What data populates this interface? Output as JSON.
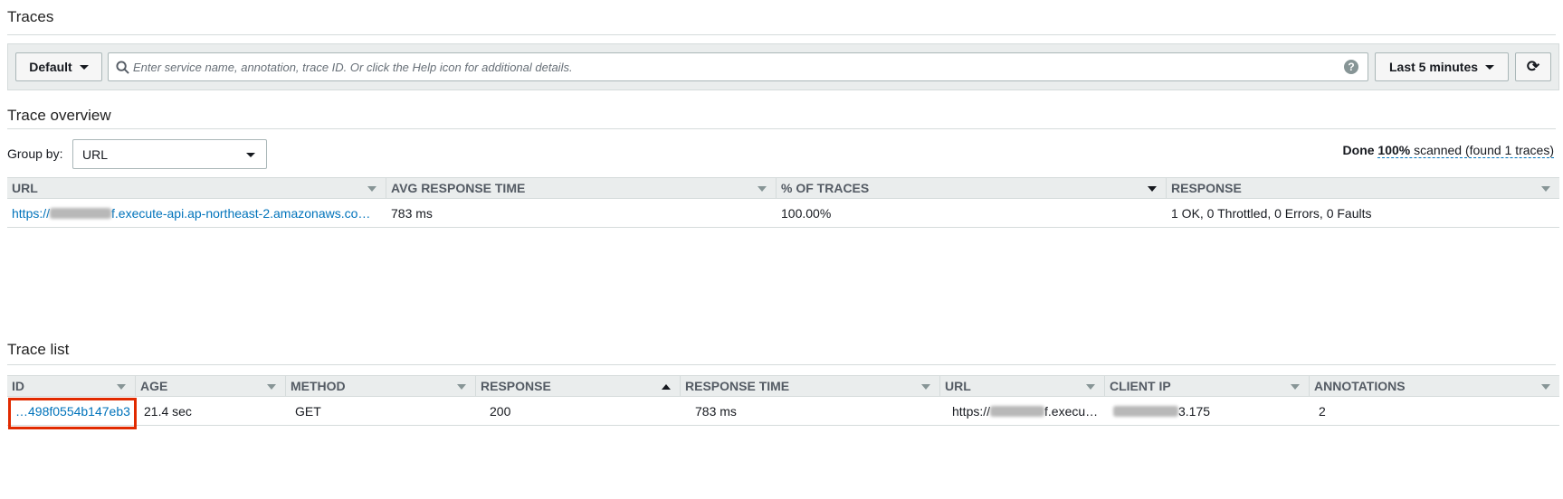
{
  "page": {
    "title": "Traces"
  },
  "toolbar": {
    "group_button": "Default",
    "search_placeholder": "Enter service name, annotation, trace ID. Or click the Help icon for additional details.",
    "help_glyph": "?",
    "time_range": "Last 5 minutes",
    "refresh_glyph": "⟳"
  },
  "overview": {
    "title": "Trace overview",
    "group_by_label": "Group by:",
    "group_by_value": "URL",
    "status_done": "Done",
    "status_percent": "100%",
    "status_rest": "scanned (found 1 traces)",
    "columns": [
      "URL",
      "AVG RESPONSE TIME",
      "% OF TRACES",
      "RESPONSE"
    ],
    "rows": [
      {
        "url_prefix": "https://",
        "url_suffix": "f.execute-api.ap-northeast-2.amazonaws.co…",
        "avg_response_time": "783 ms",
        "percent": "100.00%",
        "response": "1 OK, 0 Throttled, 0 Errors, 0 Faults"
      }
    ]
  },
  "trace_list": {
    "title": "Trace list",
    "columns": [
      "ID",
      "AGE",
      "METHOD",
      "RESPONSE",
      "RESPONSE TIME",
      "URL",
      "CLIENT IP",
      "ANNOTATIONS"
    ],
    "rows": [
      {
        "id": "…498f0554b147eb3",
        "age": "21.4 sec",
        "method": "GET",
        "response": "200",
        "response_time": "783 ms",
        "url_prefix": "https://",
        "url_suffix": "f.execu…",
        "client_ip_suffix": "3.175",
        "annotations": "2"
      }
    ]
  },
  "colors": {
    "link": "#0073bb",
    "highlight": "#e12a00",
    "header_bg": "#eaeded"
  }
}
